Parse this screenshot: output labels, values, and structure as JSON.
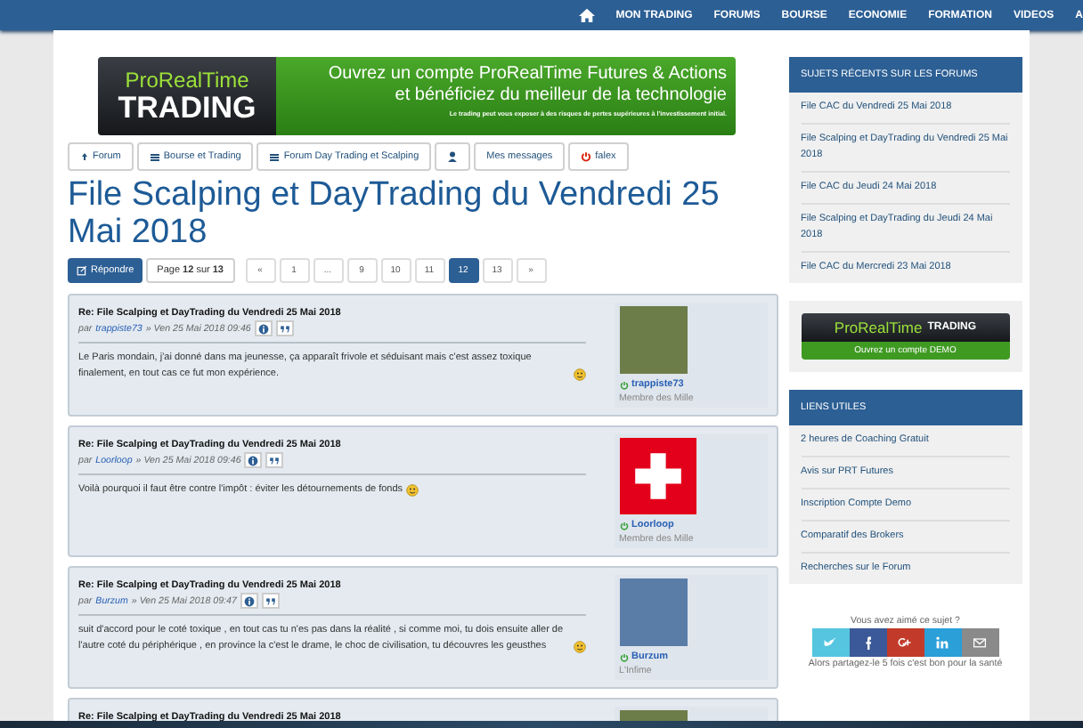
{
  "top_nav": {
    "items": [
      "MON TRADING",
      "FORUMS",
      "BOURSE",
      "ECONOMIE",
      "FORMATION",
      "VIDEOS",
      "A"
    ]
  },
  "banner": {
    "brand_top": "ProRealTime",
    "brand_bottom": "TRADING",
    "headline": "Ouvrez un compte ProRealTime Futures & Actions",
    "subline": "et bénéficiez du meilleur de la technologie",
    "disclaimer": "Le trading peut vous exposer à des risques de pertes supérieures à l'investissement initial."
  },
  "breadcrumbs": [
    {
      "kind": "up",
      "label": "Forum"
    },
    {
      "kind": "list",
      "label": "Bourse et Trading"
    },
    {
      "kind": "list",
      "label": "Forum Day Trading et Scalping"
    },
    {
      "kind": "user"
    },
    {
      "kind": "plain",
      "label": "Mes messages"
    },
    {
      "kind": "power",
      "label": "falex"
    }
  ],
  "title": "File Scalping et DayTrading du Vendredi 25 Mai 2018",
  "pagination": {
    "reply": "Répondre",
    "info": "Page **12** sur **13**",
    "pages": [
      {
        "label": "«",
        "selected": false
      },
      {
        "label": "1",
        "selected": false
      },
      {
        "label": "...",
        "selected": false
      },
      {
        "label": "9",
        "selected": false
      },
      {
        "label": "10",
        "selected": false
      },
      {
        "label": "11",
        "selected": false
      },
      {
        "label": "12",
        "selected": true
      },
      {
        "label": "13",
        "selected": false
      },
      {
        "label": "»",
        "selected": false
      }
    ]
  },
  "posts": [
    {
      "title": "Re: File Scalping et DayTrading du Vendredi 25 Mai 2018",
      "by": "par",
      "author": "trappiste73",
      "date": "» Ven 25 Mai 2018 09:46",
      "body": "Le Paris mondain, j'ai donné dans ma jeunesse, ça apparaît frivole et séduisant mais c'est assez toxique finalement, en tout cas ce fut mon expérience.",
      "smiley": true,
      "kind": "photo",
      "username": "trappiste73",
      "rank": "Membre des Mille"
    },
    {
      "title": "Re: File Scalping et DayTrading du Vendredi 25 Mai 2018",
      "by": "par",
      "author": "Loorloop",
      "date": "» Ven 25 Mai 2018 09:46",
      "body": "Voilà pourquoi il faut être contre l'impôt : éviter les détournements de fonds",
      "smiley": true,
      "kind": "flag",
      "username": "Loorloop",
      "rank": "Membre des Mille"
    },
    {
      "title": "Re: File Scalping et DayTrading du Vendredi 25 Mai 2018",
      "by": "par",
      "author": "Burzum",
      "date": "» Ven 25 Mai 2018 09:47",
      "body": "suit d'accord pour le coté toxique , en tout cas tu n'es pas dans la réalité , si comme moi, tu dois ensuite aller de l'autre coté du périphérique , en province la c'est le drame, le choc de civilisation, tu découvres les geusthes",
      "smiley": true,
      "kind": "statue",
      "username": "Burzum",
      "rank": "L'Infime"
    },
    {
      "title": "Re: File Scalping et DayTrading du Vendredi 25 Mai 2018",
      "kind": "photo"
    }
  ],
  "sidebar": {
    "recent_header": "SUJETS RÉCENTS SUR LES FORUMS",
    "recent": [
      "File CAC du Vendredi 25 Mai 2018",
      "File Scalping et DayTrading du Vendredi 25 Mai 2018",
      "File CAC du Jeudi 24 Mai 2018",
      "File Scalping et DayTrading du Jeudi 24 Mai 2018",
      "File CAC du Mercredi 23 Mai 2018"
    ],
    "demo": {
      "brand": "ProRealTime",
      "brand_small": "TRADING",
      "cta": "Ouvrez un compte DEMO"
    },
    "links_header": "LIENS UTILES",
    "links": [
      "2 heures de Coaching Gratuit",
      "Avis sur PRT Futures",
      "Inscription Compte Demo",
      "Comparatif des Brokers",
      "Recherches sur le Forum"
    ],
    "share": {
      "question": "Vous avez aimé ce sujet ?",
      "buttons": [
        {
          "kind": "twitter",
          "color": "#55c5e0"
        },
        {
          "kind": "facebook",
          "color": "#3b5998"
        },
        {
          "kind": "google",
          "color": "#c23b2a"
        },
        {
          "kind": "linkedin",
          "color": "#2a9fd8"
        },
        {
          "kind": "mail",
          "color": "#8a8a8a"
        }
      ],
      "note": "Alors partagez-le 5 fois c'est bon pour la santé"
    }
  }
}
